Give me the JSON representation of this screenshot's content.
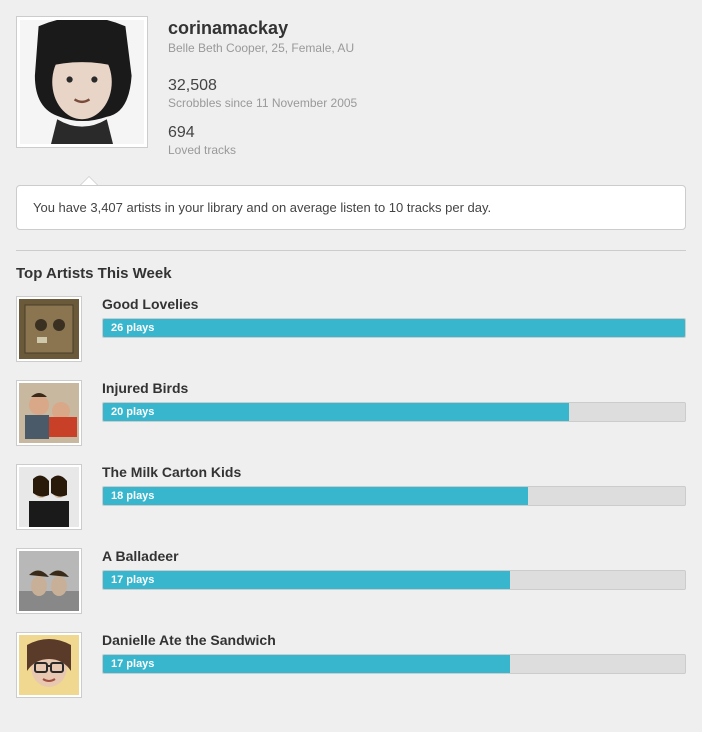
{
  "profile": {
    "username": "corinamackay",
    "subline": "Belle Beth Cooper, 25, Female, AU",
    "scrobbles_count": "32,508",
    "scrobbles_label": "Scrobbles since 11 November 2005",
    "loved_count": "694",
    "loved_label": "Loved tracks"
  },
  "callout": "You have 3,407 artists in your library and on average listen to 10 tracks per day.",
  "section_title": "Top Artists This Week",
  "artists": [
    {
      "name": "Good Lovelies",
      "plays_label": "26 plays",
      "pct": 100
    },
    {
      "name": "Injured Birds",
      "plays_label": "20 plays",
      "pct": 80
    },
    {
      "name": "The Milk Carton Kids",
      "plays_label": "18 plays",
      "pct": 73
    },
    {
      "name": "A Balladeer",
      "plays_label": "17 plays",
      "pct": 70
    },
    {
      "name": "Danielle Ate the Sandwich",
      "plays_label": "17 plays",
      "pct": 70
    }
  ]
}
